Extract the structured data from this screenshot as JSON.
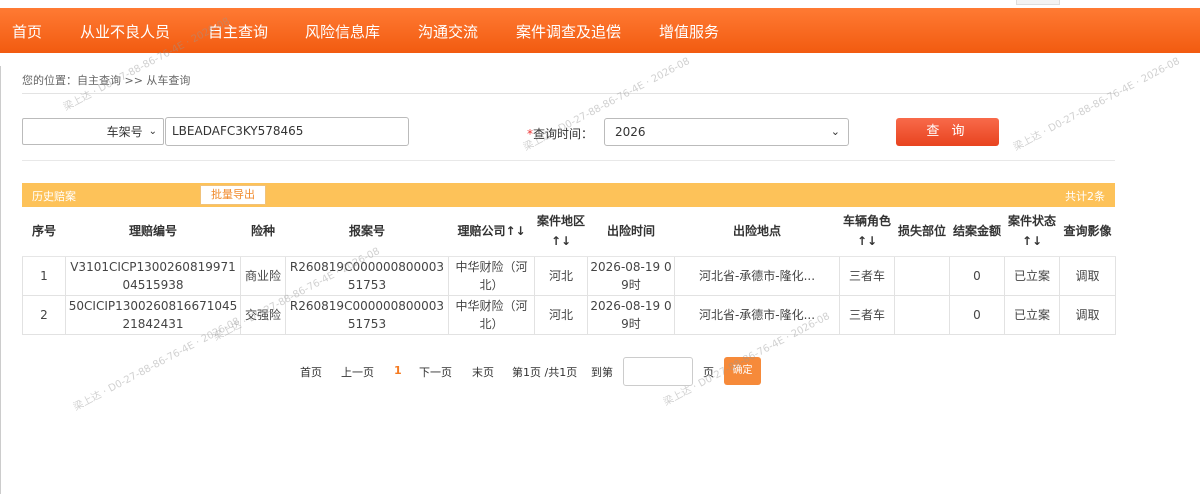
{
  "nav": {
    "items": [
      "首页",
      "从业不良人员",
      "自主查询",
      "风险信息库",
      "沟通交流",
      "案件调查及追偿",
      "增值服务"
    ]
  },
  "breadcrumb": "您的位置：自主查询 >> 从车查询",
  "search": {
    "field_type": "车架号",
    "vin_value": "LBEADAFC3KY578465",
    "time_label": "查询时间：",
    "time_required_mark": "*",
    "time_value": "2026",
    "query_button": "查 询"
  },
  "panel": {
    "title": "历史赔案",
    "export_button": "批量导出",
    "total": "共计2条"
  },
  "table": {
    "headers": [
      "序号",
      "理赔编号",
      "险种",
      "报案号",
      "理赔公司↑↓",
      "案件地区↑↓",
      "出险时间",
      "出险地点",
      "车辆角色↑↓",
      "损失部位",
      "结案金额",
      "案件状态↑↓",
      "查询影像"
    ],
    "rows": [
      [
        "1",
        "V3101CICP130026081997104515938",
        "商业险",
        "R260819C00000080000351753",
        "中华财险（河北）",
        "河北",
        "2026-08-19 09时",
        "河北省-承德市-隆化...",
        "三者车",
        "",
        "0",
        "已立案",
        "调取"
      ],
      [
        "2",
        "50CICIP130026081667104521842431",
        "交强险",
        "R260819C00000080000351753",
        "中华财险（河北）",
        "河北",
        "2026-08-19 09时",
        "河北省-承德市-隆化...",
        "三者车",
        "",
        "0",
        "已立案",
        "调取"
      ]
    ]
  },
  "pager": {
    "first": "首页",
    "prev": "上一页",
    "current": "1",
    "next": "下一页",
    "last": "末页",
    "info": "第1页 /共1页",
    "goto": "到第",
    "page_unit": "页",
    "confirm": "确定"
  },
  "watermark": "梁上达 · D0-27-88-86-76-4E · 2026-08"
}
